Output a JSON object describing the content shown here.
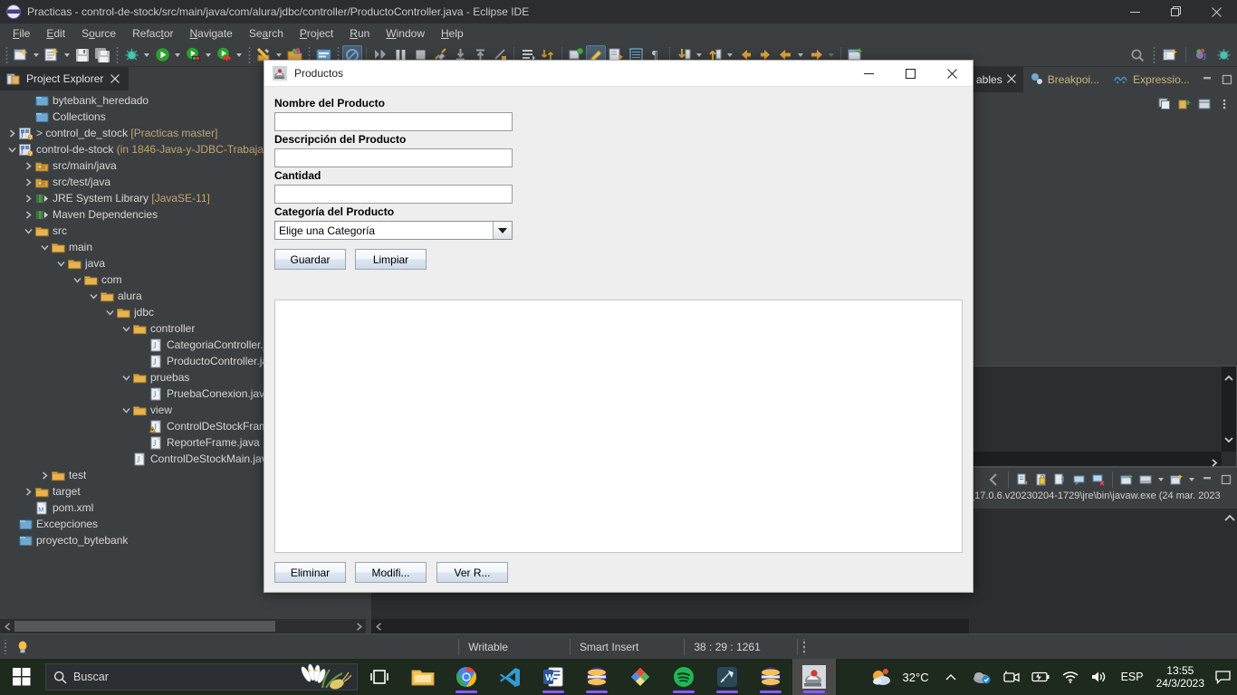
{
  "window": {
    "title": "Practicas - control-de-stock/src/main/java/com/alura/jdbc/controller/ProductoController.java - Eclipse IDE",
    "app_icon": "eclipse-icon",
    "minimize": "–",
    "maximize": "❐",
    "close": "✕"
  },
  "menu": [
    {
      "label": "File",
      "mnemonic": "F"
    },
    {
      "label": "Edit",
      "mnemonic": "E"
    },
    {
      "label": "Source",
      "mnemonic": "o"
    },
    {
      "label": "Refactor",
      "mnemonic": "t"
    },
    {
      "label": "Navigate",
      "mnemonic": "N"
    },
    {
      "label": "Search",
      "mnemonic": "a"
    },
    {
      "label": "Project",
      "mnemonic": "P"
    },
    {
      "label": "Run",
      "mnemonic": "R"
    },
    {
      "label": "Window",
      "mnemonic": "W"
    },
    {
      "label": "Help",
      "mnemonic": "H"
    }
  ],
  "toolbar": {
    "icons": [
      "new-wizard-icon",
      "new-java-class-icon",
      "save-icon",
      "save-all-icon",
      "debug-icon",
      "run-icon",
      "run-coverage-icon",
      "run-external-tools-icon",
      "new-java-project-icon",
      "open-type-icon",
      "open-task-icon",
      "skip-breakpoints-icon",
      "step-over-icon",
      "pause-icon",
      "terminate-icon",
      "disconnect-icon",
      "step-into-icon",
      "step-return-icon",
      "step-filters-icon",
      "next-annotation-icon",
      "previous-annotation-icon",
      "last-edit-icon",
      "toggle-mark-occurrences-icon",
      "toggle-block-selection-icon",
      "show-whitespace-icon",
      "pilcrow-icon",
      "next-member-icon",
      "previous-member-icon",
      "back-icon",
      "forward-icon",
      "back-history-icon",
      "forward-history-icon",
      "new-window-icon"
    ],
    "right_icons": [
      "search-icon",
      "open-perspective-icon",
      "java-perspective-icon",
      "debug-perspective-icon"
    ]
  },
  "project_explorer": {
    "tab_label": "Project Explorer",
    "tab_icon": "project-explorer-icon",
    "close_icon": "close-icon",
    "tools": [
      "collapse-all-icon",
      "link-with-editor-icon",
      "view-menu-icon"
    ],
    "tree": [
      {
        "indent": 1,
        "chevron": "none",
        "icon": "project-closed-icon",
        "label": "bytebank_heredado",
        "decor": ""
      },
      {
        "indent": 1,
        "chevron": "none",
        "icon": "project-closed-icon",
        "label": "Collections",
        "decor": ""
      },
      {
        "indent": 0,
        "chevron": "collapsed",
        "icon": "java-project-icon",
        "label": "> control_de_stock",
        "decor": " [Practicas master]"
      },
      {
        "indent": 0,
        "chevron": "expanded",
        "icon": "java-project-icon",
        "label": "control-de-stock",
        "decor": " (in 1846-Java-y-JDBC-Trabajar"
      },
      {
        "indent": 1,
        "chevron": "collapsed",
        "icon": "source-folder-icon",
        "label": "src/main/java",
        "decor": ""
      },
      {
        "indent": 1,
        "chevron": "collapsed",
        "icon": "source-folder-icon",
        "label": "src/test/java",
        "decor": ""
      },
      {
        "indent": 1,
        "chevron": "collapsed",
        "icon": "library-icon",
        "label": "JRE System Library",
        "decor": " [JavaSE-11]"
      },
      {
        "indent": 1,
        "chevron": "collapsed",
        "icon": "library-icon",
        "label": "Maven Dependencies",
        "decor": ""
      },
      {
        "indent": 1,
        "chevron": "expanded",
        "icon": "folder-icon",
        "label": "src",
        "decor": ""
      },
      {
        "indent": 2,
        "chevron": "expanded",
        "icon": "folder-icon",
        "label": "main",
        "decor": ""
      },
      {
        "indent": 3,
        "chevron": "expanded",
        "icon": "folder-icon",
        "label": "java",
        "decor": ""
      },
      {
        "indent": 4,
        "chevron": "expanded",
        "icon": "folder-icon",
        "label": "com",
        "decor": ""
      },
      {
        "indent": 5,
        "chevron": "expanded",
        "icon": "folder-icon",
        "label": "alura",
        "decor": ""
      },
      {
        "indent": 6,
        "chevron": "expanded",
        "icon": "folder-icon",
        "label": "jdbc",
        "decor": ""
      },
      {
        "indent": 7,
        "chevron": "expanded",
        "icon": "folder-icon",
        "label": "controller",
        "decor": ""
      },
      {
        "indent": 8,
        "chevron": "none",
        "icon": "java-file-icon",
        "label": "CategoriaController.java",
        "decor": ""
      },
      {
        "indent": 8,
        "chevron": "none",
        "icon": "java-file-icon",
        "label": "ProductoController.java",
        "decor": ""
      },
      {
        "indent": 7,
        "chevron": "expanded",
        "icon": "folder-icon",
        "label": "pruebas",
        "decor": ""
      },
      {
        "indent": 8,
        "chevron": "none",
        "icon": "java-file-icon",
        "label": "PruebaConexion.java",
        "decor": ""
      },
      {
        "indent": 7,
        "chevron": "expanded",
        "icon": "folder-icon",
        "label": "view",
        "decor": ""
      },
      {
        "indent": 8,
        "chevron": "none",
        "icon": "java-file-warning-icon",
        "label": "ControlDeStockFrame.java",
        "decor": ""
      },
      {
        "indent": 8,
        "chevron": "none",
        "icon": "java-file-icon",
        "label": "ReporteFrame.java",
        "decor": ""
      },
      {
        "indent": 7,
        "chevron": "none",
        "icon": "java-file-icon",
        "label": "ControlDeStockMain.java",
        "decor": ""
      },
      {
        "indent": 2,
        "chevron": "collapsed",
        "icon": "folder-icon",
        "label": "test",
        "decor": ""
      },
      {
        "indent": 1,
        "chevron": "collapsed",
        "icon": "folder-icon",
        "label": "target",
        "decor": ""
      },
      {
        "indent": 1,
        "chevron": "none",
        "icon": "maven-file-icon",
        "label": "pom.xml",
        "decor": ""
      },
      {
        "indent": 0,
        "chevron": "none",
        "icon": "project-closed-icon",
        "label": "Excepciones",
        "decor": ""
      },
      {
        "indent": 0,
        "chevron": "none",
        "icon": "project-closed-icon",
        "label": "proyecto_bytebank",
        "decor": ""
      }
    ]
  },
  "right_panel": {
    "tabs": [
      {
        "label": "ables",
        "icon": "variables-icon",
        "active": true,
        "closeable": true
      },
      {
        "label": "Breakpoi...",
        "icon": "breakpoints-icon",
        "active": false,
        "closeable": false
      },
      {
        "label": "Expressio...",
        "icon": "expressions-icon",
        "active": false,
        "closeable": false
      }
    ],
    "minimize_icon": "minimize-icon",
    "maximize_icon": "maximize-icon",
    "view_tools": [
      "collapse-all-icon",
      "add-watch-icon",
      "layout-icon",
      "view-menu-icon"
    ],
    "console_tools": [
      "terminate-icon",
      "remove-launch-icon",
      "remove-all-icon",
      "show-console-icon",
      "pin-console-icon",
      "display-selected-icon",
      "scroll-lock-icon",
      "clear-console-icon",
      "new-console-icon"
    ],
    "console_line": "_17.0.6.v20230204-1729\\jre\\bin\\javaw.exe  (24 mar. 2023"
  },
  "status_bar": {
    "hint_icon": "lightbulb-icon",
    "writable": "Writable",
    "insert_mode": "Smart Insert",
    "position": "38 : 29 : 1261"
  },
  "dialog": {
    "title": "Productos",
    "icon": "java-duke-coffee-icon",
    "minimize": "–",
    "maximize": "❐",
    "close": "✕",
    "fields": [
      {
        "label": "Nombre del Producto",
        "value": "",
        "name": "nombre-producto"
      },
      {
        "label": "Descripción del Producto",
        "value": "",
        "name": "descripcion-producto"
      },
      {
        "label": "Cantidad",
        "value": "",
        "name": "cantidad"
      }
    ],
    "category": {
      "label": "Categoría del Producto",
      "selected": "Elige una Categoría",
      "dropdown_icon": "chevron-down-icon"
    },
    "top_buttons": [
      {
        "label": "Guardar",
        "name": "guardar-button"
      },
      {
        "label": "Limpiar",
        "name": "limpiar-button"
      }
    ],
    "bottom_buttons": [
      {
        "label": "Eliminar",
        "name": "eliminar-button"
      },
      {
        "label": "Modifi...",
        "name": "modificar-button"
      },
      {
        "label": "Ver R...",
        "name": "ver-reporte-button"
      }
    ]
  },
  "taskbar": {
    "start_icon": "windows-start-icon",
    "search_placeholder": "Buscar",
    "search_icon": "search-icon",
    "task_view_icon": "task-view-icon",
    "apps": [
      {
        "name": "file-explorer-icon",
        "running": false
      },
      {
        "name": "google-chrome-icon",
        "running": true
      },
      {
        "name": "visual-studio-code-icon",
        "running": false
      },
      {
        "name": "microsoft-word-icon",
        "running": true
      },
      {
        "name": "eclipse-icon",
        "running": true
      },
      {
        "name": "google-drive-icon",
        "running": false
      },
      {
        "name": "spotify-icon",
        "running": true
      },
      {
        "name": "postman-icon",
        "running": true
      },
      {
        "name": "eclipse-icon-2",
        "running": true
      },
      {
        "name": "java-app-icon",
        "running": true,
        "active": true
      }
    ],
    "tray": {
      "weather_icon": "weather-partly-cloudy-icon",
      "temperature": "32°C",
      "overflow_icon": "chevron-up-icon",
      "hidden_icons": [
        "onedrive-icon",
        "camera-icon",
        "battery-icon"
      ],
      "network_icon": "wifi-icon",
      "volume_icon": "speaker-icon",
      "language": "ESP",
      "time": "13:55",
      "date": "24/3/2023",
      "notifications_icon": "action-center-icon"
    }
  },
  "colors": {
    "eclipse_bg": "#3c3f41",
    "eclipse_dark": "#2b2d30",
    "accent_orange": "#c5a46d",
    "dialog_bg": "#eeeeee",
    "taskbar_bg": "#1d2a1d"
  }
}
